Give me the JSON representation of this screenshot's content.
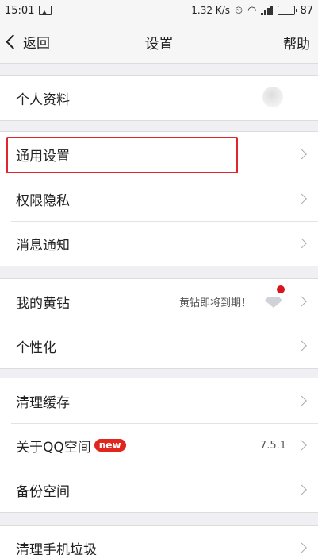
{
  "status": {
    "time": "15:01",
    "speed": "1.32 K/s",
    "battery": "87"
  },
  "nav": {
    "back_label": "返回",
    "title": "设置",
    "help_label": "帮助"
  },
  "groups": [
    {
      "rows": [
        {
          "label": "个人资料"
        }
      ]
    },
    {
      "rows": [
        {
          "label": "通用设置"
        },
        {
          "label": "权限隐私"
        },
        {
          "label": "消息通知"
        }
      ]
    },
    {
      "rows": [
        {
          "label": "我的黄钻",
          "right_text": "黄钻即将到期！"
        },
        {
          "label": "个性化"
        }
      ]
    },
    {
      "rows": [
        {
          "label": "清理缓存"
        },
        {
          "label": "关于QQ空间",
          "badge": "new",
          "right_text": "7.5.1"
        },
        {
          "label": "备份空间"
        }
      ]
    },
    {
      "rows": [
        {
          "label": "清理手机垃圾"
        }
      ]
    }
  ],
  "colors": {
    "accent_red": "#e0262c",
    "badge_red": "#e0261d"
  }
}
